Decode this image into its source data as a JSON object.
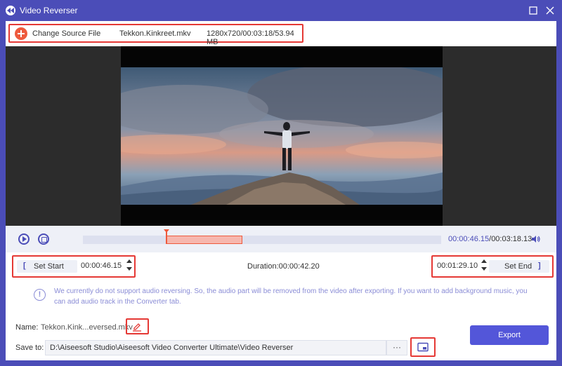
{
  "window": {
    "title": "Video Reverser",
    "accent": "#4b4db8",
    "highlight_border": "#e53935"
  },
  "source": {
    "change_label": "Change Source File",
    "file_name": "Tekkon.Kinkreet.mkv",
    "file_info": "1280x720/00:03:18/53.94 MB"
  },
  "playback": {
    "current_time": "00:00:46.15",
    "total_time": "00:03:18.13",
    "separator": "/",
    "selection_start_fraction": 0.2327,
    "selection_end_fraction": 0.4448,
    "playhead_fraction": 0.2327
  },
  "range": {
    "set_start_label": "Set Start",
    "start_bracket": "[",
    "start_time": "00:00:46.15",
    "duration": "Duration:00:00:42.20",
    "end_time": "00:01:29.10",
    "set_end_label": "Set End",
    "end_bracket": "]"
  },
  "notice": {
    "icon": "!",
    "text": "We currently do not support audio reversing. So, the audio part will be removed from the video after exporting. If you want to add background music, you can add audio track in the Converter tab."
  },
  "output": {
    "name_label": "Name:",
    "name_value": "Tekkon.Kink...eversed.mkv",
    "save_label": "Save to:",
    "save_path": "D:\\Aiseesoft Studio\\Aiseesoft Video Converter Ultimate\\Video Reverser",
    "browse_label": "···",
    "export_label": "Export"
  }
}
